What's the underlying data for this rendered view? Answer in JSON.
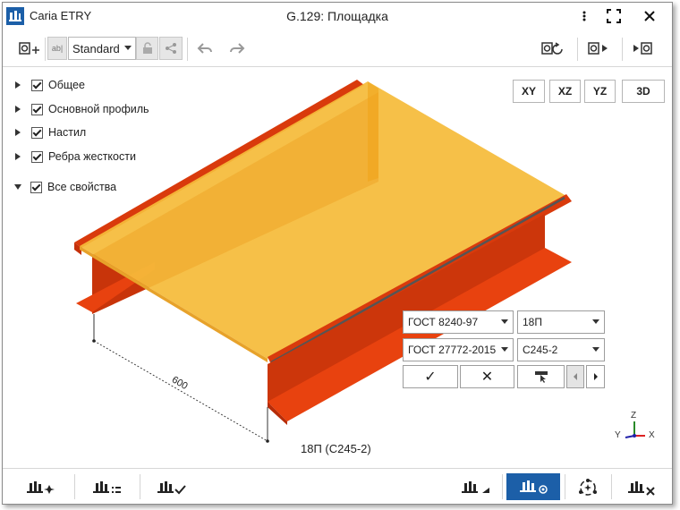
{
  "app": {
    "title": "Caria ETRY",
    "document_title": "G.129: Площадка",
    "window_controls": [
      "more-icon",
      "maximize-icon",
      "close-icon"
    ]
  },
  "toolbar": {
    "style_value": "Standard",
    "text_icon_label": "ab|"
  },
  "tree": {
    "items": [
      {
        "label": "Общее",
        "expanded": false,
        "checked": true
      },
      {
        "label": "Основной профиль",
        "expanded": false,
        "checked": true
      },
      {
        "label": "Настил",
        "expanded": false,
        "checked": true
      },
      {
        "label": "Ребра жесткости",
        "expanded": false,
        "checked": true
      },
      {
        "label": "Все свойства",
        "expanded": true,
        "checked": true
      }
    ]
  },
  "view_buttons": [
    "XY",
    "XZ",
    "YZ",
    "3D"
  ],
  "scene": {
    "dimension_label": "600",
    "profile_label": "18П (С245-2)"
  },
  "edit_panel": {
    "standard1": "ГОСТ 8240-97",
    "profile": "18П",
    "standard2": "ГОСТ 27772-2015",
    "steel": "С245-2",
    "confirm_glyph": "✓",
    "cancel_glyph": "✕"
  },
  "axes": {
    "z": "Z",
    "y": "Y",
    "x": "X"
  },
  "colors": {
    "accent": "#1c5fa8",
    "beam": "#e8420f",
    "deck": "#f3b731"
  }
}
